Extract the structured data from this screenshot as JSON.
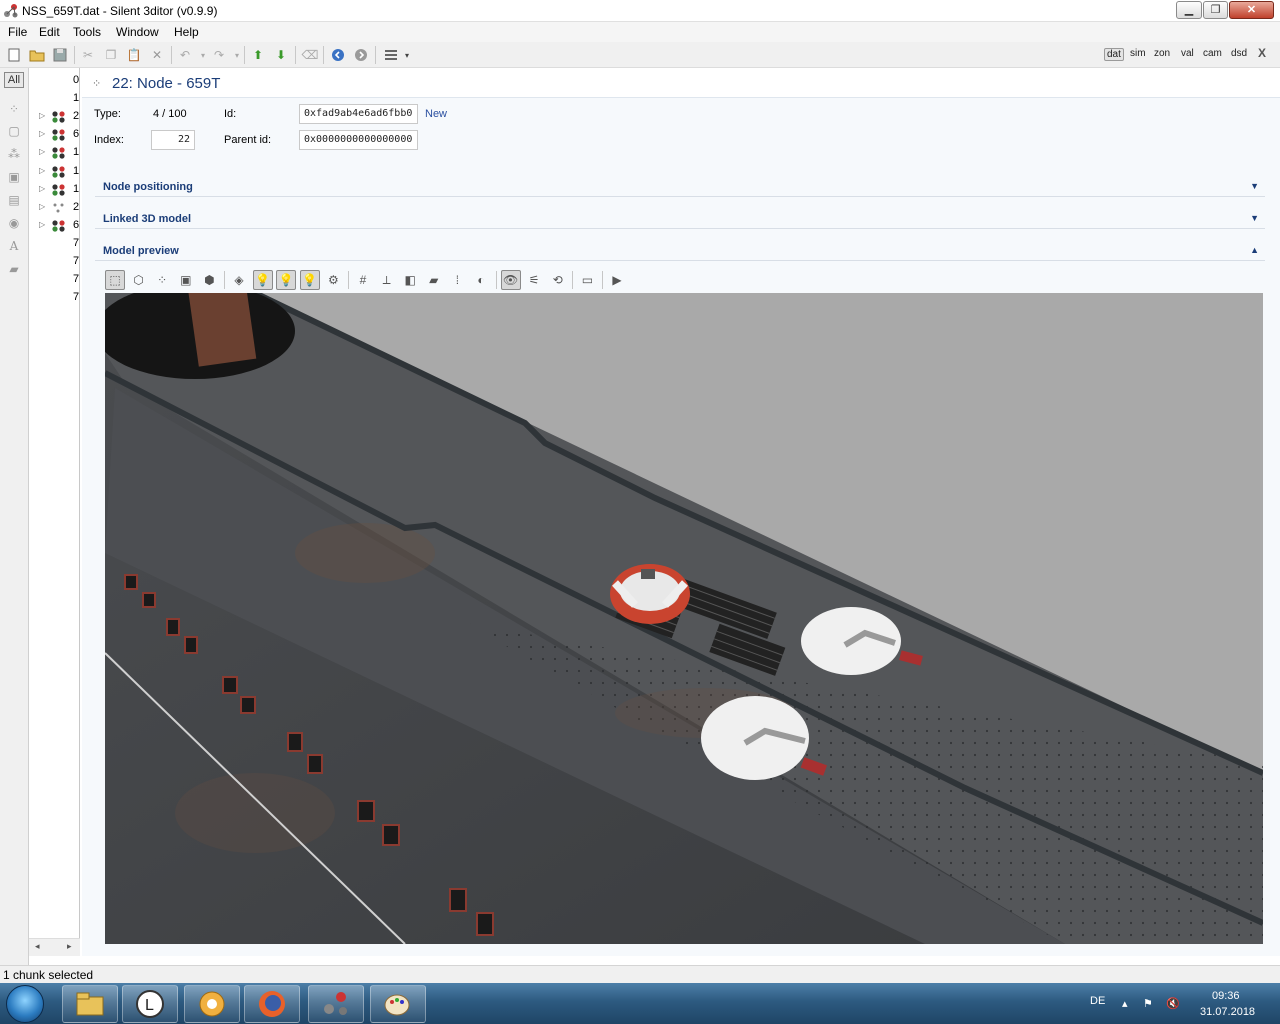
{
  "window": {
    "title": "NSS_659T.dat - Silent 3ditor (v0.9.9)",
    "controls": {
      "minimize": "▁",
      "maximize": "❐",
      "close": "✕"
    }
  },
  "menu": [
    "File",
    "Edit",
    "Tools",
    "Window",
    "Help"
  ],
  "toolbar": {
    "icons": [
      "new-file-icon",
      "open-folder-icon",
      "save-icon",
      "cut-icon",
      "copy-icon",
      "paste-icon",
      "delete-icon",
      "undo-icon",
      "redo-icon",
      "move-up-icon",
      "move-down-icon",
      "clear-icon",
      "back-icon",
      "forward-icon",
      "view-mode-icon"
    ],
    "context_tabs": [
      "dat",
      "sim",
      "zon",
      "val",
      "cam",
      "dsd"
    ],
    "active_context": "dat",
    "close_label": "X"
  },
  "sidebar": {
    "filter_label": "All",
    "icons": [
      "node-filter-icon",
      "mesh-filter-icon",
      "material-filter-icon",
      "texture-filter-icon",
      "document-filter-icon",
      "sound-filter-icon",
      "font-filter-icon",
      "unknown-filter-icon"
    ]
  },
  "tree": {
    "rows": [
      {
        "label": "0",
        "expandable": false,
        "icon": "none"
      },
      {
        "label": "1",
        "expandable": false,
        "icon": "none"
      },
      {
        "label": "2",
        "expandable": true,
        "icon": "molecule"
      },
      {
        "label": "6",
        "expandable": true,
        "icon": "molecule"
      },
      {
        "label": "1",
        "expandable": true,
        "icon": "molecule"
      },
      {
        "label": "1",
        "expandable": true,
        "icon": "molecule"
      },
      {
        "label": "1",
        "expandable": true,
        "icon": "molecule"
      },
      {
        "label": "2",
        "expandable": true,
        "icon": "node"
      },
      {
        "label": "6",
        "expandable": true,
        "icon": "molecule"
      },
      {
        "label": "7",
        "expandable": false,
        "icon": "none"
      },
      {
        "label": "7",
        "expandable": false,
        "icon": "none"
      },
      {
        "label": "7",
        "expandable": false,
        "icon": "none"
      },
      {
        "label": "7",
        "expandable": false,
        "icon": "none"
      }
    ],
    "scroll_left": "◂",
    "scroll_right": "▸"
  },
  "node": {
    "title": "22: Node - 659T",
    "type_label": "Type:",
    "type_value": "4 / 100",
    "id_label": "Id:",
    "id_value": "0xfad9ab4e6ad6fbb0",
    "id_new_link": "New",
    "index_label": "Index:",
    "index_value": "22",
    "parent_id_label": "Parent id:",
    "parent_id_value": "0x0000000000000000"
  },
  "sections": [
    {
      "title": "Node positioning",
      "expanded": false,
      "chevron": "▼"
    },
    {
      "title": "Linked 3D model",
      "expanded": false,
      "chevron": "▼"
    },
    {
      "title": "Model preview",
      "expanded": true,
      "chevron": "▲"
    }
  ],
  "preview_toolbar": {
    "tools": [
      {
        "name": "solid-view-icon",
        "on": true
      },
      {
        "name": "wireframe-view-icon",
        "on": false
      },
      {
        "name": "points-view-icon",
        "on": false
      },
      {
        "name": "textured-box-icon",
        "on": false
      },
      {
        "name": "bounding-box-icon",
        "on": false
      },
      {
        "name": "materials-icon",
        "on": false
      },
      {
        "name": "light-1-icon",
        "on": true
      },
      {
        "name": "light-2-icon",
        "on": true
      },
      {
        "name": "light-3-icon",
        "on": true
      },
      {
        "name": "light-settings-icon",
        "on": false
      },
      {
        "name": "grid-icon",
        "on": false
      },
      {
        "name": "axes-icon",
        "on": false
      },
      {
        "name": "cube-icon",
        "on": false
      },
      {
        "name": "plane-icon",
        "on": false
      },
      {
        "name": "normals-icon",
        "on": false
      },
      {
        "name": "shading-icon",
        "on": false
      },
      {
        "name": "eye-icon",
        "on": true
      },
      {
        "name": "tracks-icon",
        "on": false
      },
      {
        "name": "reset-icon",
        "on": false
      },
      {
        "name": "camera-icon",
        "on": false
      },
      {
        "name": "play-icon",
        "on": false
      }
    ]
  },
  "status": {
    "text": "1 chunk selected"
  },
  "taskbar": {
    "apps": [
      "explorer-icon",
      "lingoes-icon",
      "media-icon",
      "firefox-icon",
      "silent3ditor-icon",
      "paint-icon"
    ],
    "language": "DE",
    "time": "09:36",
    "date": "31.07.2018"
  },
  "colors": {
    "accent": "#1b3d78",
    "link": "#2a4fa0",
    "viewport_bg": "#a9a9a9",
    "hull": "#4f5256",
    "lifebuoy": "#c9442f"
  }
}
